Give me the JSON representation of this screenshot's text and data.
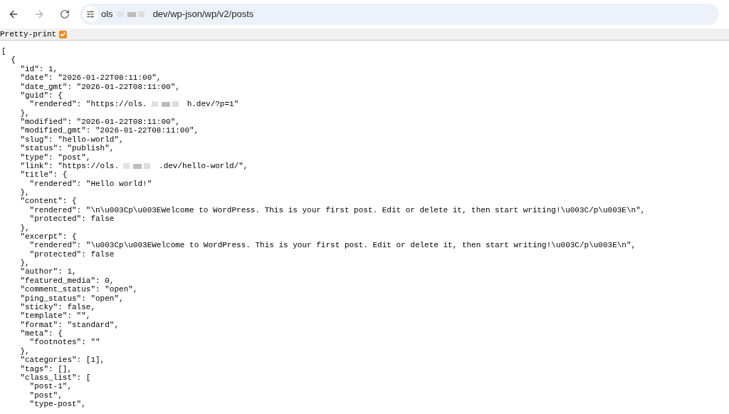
{
  "toolbar": {
    "back_enabled": true,
    "forward_enabled": false,
    "address": {
      "host_start": "ols",
      "path": "dev/wp-json/wp/v2/posts"
    }
  },
  "pretty_print": {
    "label": "Pretty-print",
    "checked": true
  },
  "lines": [
    {
      "kind": "plain",
      "text": "["
    },
    {
      "kind": "plain",
      "text": "  {"
    },
    {
      "kind": "plain",
      "text": "    \"id\": 1,"
    },
    {
      "kind": "plain",
      "text": "    \"date\": \"2026-01-22T08:11:00\","
    },
    {
      "kind": "plain",
      "text": "    \"date_gmt\": \"2026-01-22T08:11:00\","
    },
    {
      "kind": "plain",
      "text": "    \"guid\": {"
    },
    {
      "kind": "redacted",
      "before": "      \"rendered\": \"https://ols.",
      "after": "h.dev/?p=1\""
    },
    {
      "kind": "plain",
      "text": "    },"
    },
    {
      "kind": "plain",
      "text": "    \"modified\": \"2026-01-22T08:11:00\","
    },
    {
      "kind": "plain",
      "text": "    \"modified_gmt\": \"2026-01-22T08:11:00\","
    },
    {
      "kind": "plain",
      "text": "    \"slug\": \"hello-world\","
    },
    {
      "kind": "plain",
      "text": "    \"status\": \"publish\","
    },
    {
      "kind": "plain",
      "text": "    \"type\": \"post\","
    },
    {
      "kind": "redacted",
      "before": "    \"link\": \"https://ols.",
      "after": ".dev/hello-world/\","
    },
    {
      "kind": "plain",
      "text": "    \"title\": {"
    },
    {
      "kind": "plain",
      "text": "      \"rendered\": \"Hello world!\""
    },
    {
      "kind": "plain",
      "text": "    },"
    },
    {
      "kind": "plain",
      "text": "    \"content\": {"
    },
    {
      "kind": "plain",
      "text": "      \"rendered\": \"\\n\\u003Cp\\u003EWelcome to WordPress. This is your first post. Edit or delete it, then start writing!\\u003C/p\\u003E\\n\","
    },
    {
      "kind": "plain",
      "text": "      \"protected\": false"
    },
    {
      "kind": "plain",
      "text": "    },"
    },
    {
      "kind": "plain",
      "text": "    \"excerpt\": {"
    },
    {
      "kind": "plain",
      "text": "      \"rendered\": \"\\u003Cp\\u003EWelcome to WordPress. This is your first post. Edit or delete it, then start writing!\\u003C/p\\u003E\\n\","
    },
    {
      "kind": "plain",
      "text": "      \"protected\": false"
    },
    {
      "kind": "plain",
      "text": "    },"
    },
    {
      "kind": "plain",
      "text": "    \"author\": 1,"
    },
    {
      "kind": "plain",
      "text": "    \"featured_media\": 0,"
    },
    {
      "kind": "plain",
      "text": "    \"comment_status\": \"open\","
    },
    {
      "kind": "plain",
      "text": "    \"ping_status\": \"open\","
    },
    {
      "kind": "plain",
      "text": "    \"sticky\": false,"
    },
    {
      "kind": "plain",
      "text": "    \"template\": \"\","
    },
    {
      "kind": "plain",
      "text": "    \"format\": \"standard\","
    },
    {
      "kind": "plain",
      "text": "    \"meta\": {"
    },
    {
      "kind": "plain",
      "text": "      \"footnotes\": \"\""
    },
    {
      "kind": "plain",
      "text": "    },"
    },
    {
      "kind": "plain",
      "text": "    \"categories\": [1],"
    },
    {
      "kind": "plain",
      "text": "    \"tags\": [],"
    },
    {
      "kind": "plain",
      "text": "    \"class_list\": ["
    },
    {
      "kind": "plain",
      "text": "      \"post-1\","
    },
    {
      "kind": "plain",
      "text": "      \"post\","
    },
    {
      "kind": "plain",
      "text": "      \"type-post\","
    }
  ]
}
